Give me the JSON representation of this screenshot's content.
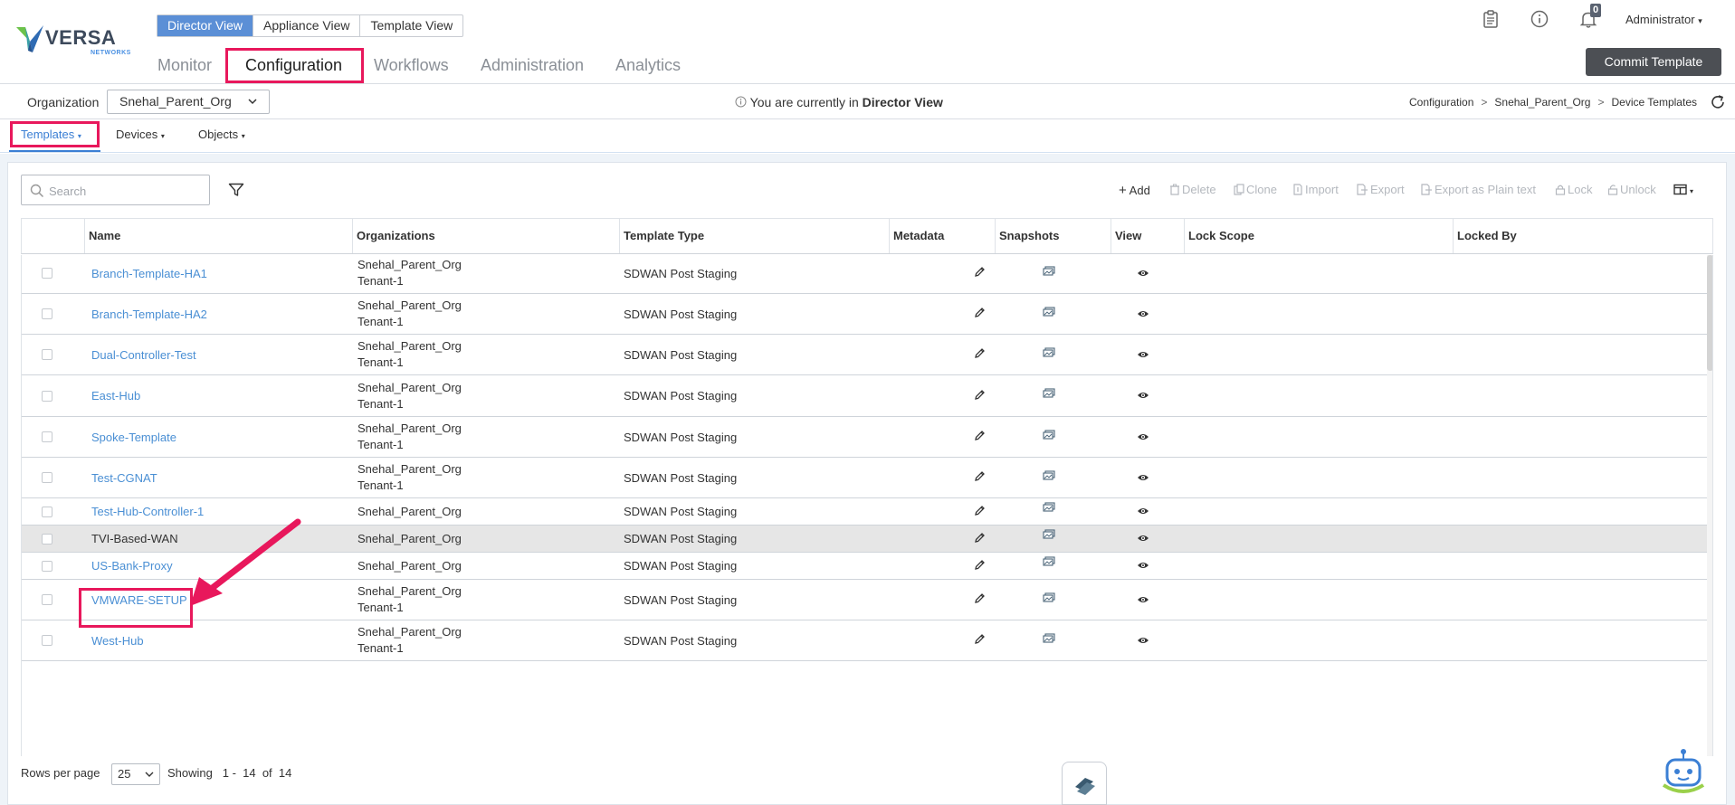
{
  "brand": {
    "name": "VERSA",
    "sub": "NETWORKS"
  },
  "view_switch": [
    {
      "label": "Director View",
      "active": true
    },
    {
      "label": "Appliance View",
      "active": false
    },
    {
      "label": "Template View",
      "active": false
    }
  ],
  "main_nav": [
    {
      "label": "Monitor",
      "active": false
    },
    {
      "label": "Configuration",
      "active": true
    },
    {
      "label": "Workflows",
      "active": false
    },
    {
      "label": "Administration",
      "active": false
    },
    {
      "label": "Analytics",
      "active": false
    }
  ],
  "header": {
    "notifications_count": "0",
    "user": "Administrator",
    "commit_button": "Commit Template",
    "icons": [
      "clipboard-icon",
      "info-icon",
      "bell-icon"
    ]
  },
  "org_bar": {
    "label": "Organization",
    "selected_org": "Snehal_Parent_Org",
    "view_info_prefix": "You are currently in",
    "view_info_value": "Director View",
    "breadcrumb": [
      "Configuration",
      "Snehal_Parent_Org",
      "Device Templates"
    ]
  },
  "sub_tabs": [
    {
      "label": "Templates",
      "active": true
    },
    {
      "label": "Devices",
      "active": false
    },
    {
      "label": "Objects",
      "active": false
    }
  ],
  "search": {
    "placeholder": "Search",
    "value": ""
  },
  "toolbar": {
    "add": "Add",
    "delete": "Delete",
    "clone": "Clone",
    "import": "Import",
    "export": "Export",
    "export_plain": "Export as Plain text",
    "lock": "Lock",
    "unlock": "Unlock"
  },
  "table": {
    "columns": [
      "Name",
      "Organizations",
      "Template Type",
      "Metadata",
      "Snapshots",
      "View",
      "Lock Scope",
      "Locked By"
    ],
    "rows": [
      {
        "name": "Branch-Template-HA1",
        "orgs": [
          "Snehal_Parent_Org",
          "Tenant-1"
        ],
        "type": "SDWAN Post Staging",
        "selected": false
      },
      {
        "name": "Branch-Template-HA2",
        "orgs": [
          "Snehal_Parent_Org",
          "Tenant-1"
        ],
        "type": "SDWAN Post Staging",
        "selected": false
      },
      {
        "name": "Dual-Controller-Test",
        "orgs": [
          "Snehal_Parent_Org",
          "Tenant-1"
        ],
        "type": "SDWAN Post Staging",
        "selected": false
      },
      {
        "name": "East-Hub",
        "orgs": [
          "Snehal_Parent_Org",
          "Tenant-1"
        ],
        "type": "SDWAN Post Staging",
        "selected": false
      },
      {
        "name": "Spoke-Template",
        "orgs": [
          "Snehal_Parent_Org",
          "Tenant-1"
        ],
        "type": "SDWAN Post Staging",
        "selected": false
      },
      {
        "name": "Test-CGNAT",
        "orgs": [
          "Snehal_Parent_Org",
          "Tenant-1"
        ],
        "type": "SDWAN Post Staging",
        "selected": false
      },
      {
        "name": "Test-Hub-Controller-1",
        "orgs": [
          "Snehal_Parent_Org"
        ],
        "type": "SDWAN Post Staging",
        "selected": false
      },
      {
        "name": "TVI-Based-WAN",
        "orgs": [
          "Snehal_Parent_Org"
        ],
        "type": "SDWAN Post Staging",
        "selected": true
      },
      {
        "name": "US-Bank-Proxy",
        "orgs": [
          "Snehal_Parent_Org"
        ],
        "type": "SDWAN Post Staging",
        "selected": false
      },
      {
        "name": "VMWARE-SETUP",
        "orgs": [
          "Snehal_Parent_Org",
          "Tenant-1"
        ],
        "type": "SDWAN Post Staging",
        "selected": false
      },
      {
        "name": "West-Hub",
        "orgs": [
          "Snehal_Parent_Org",
          "Tenant-1"
        ],
        "type": "SDWAN Post Staging",
        "selected": false
      }
    ]
  },
  "footer": {
    "rows_per_page_label": "Rows per page",
    "rows_per_page": "25",
    "showing_label": "Showing",
    "range_start": "1",
    "range_end": "14",
    "of_label": "of",
    "total": "14"
  },
  "colors": {
    "accent": "#3b7fd4",
    "active_view": "#5b8fd6",
    "highlight": "#e8185c",
    "commit_bg": "#4c4f54",
    "link": "#4a8fd4",
    "selected_row": "#e6e6e6"
  }
}
